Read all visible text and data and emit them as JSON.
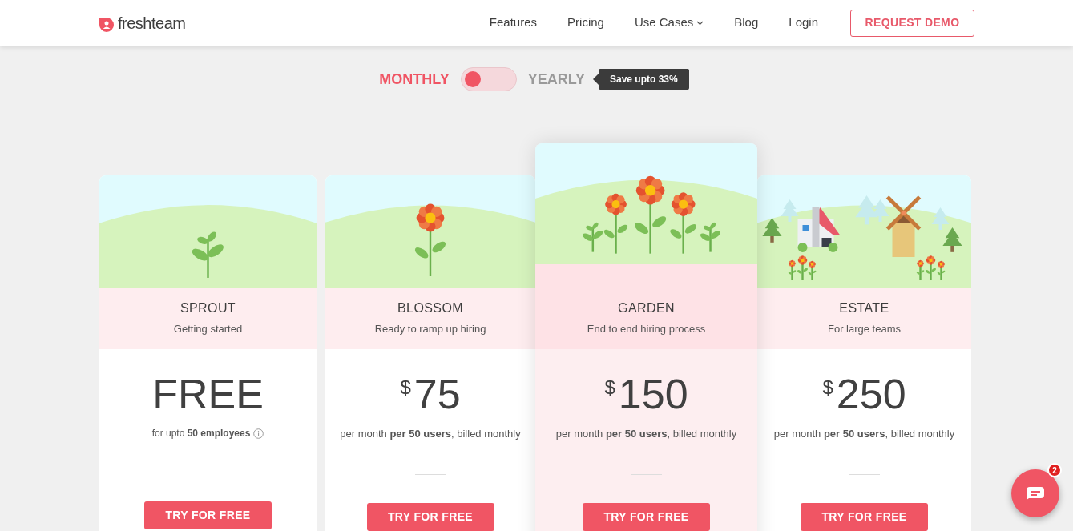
{
  "header": {
    "logo": "freshteam",
    "nav": [
      {
        "label": "Features",
        "kind": "link"
      },
      {
        "label": "Pricing",
        "kind": "link"
      },
      {
        "label": "Use Cases",
        "kind": "dropdown"
      },
      {
        "label": "Blog",
        "kind": "link"
      },
      {
        "label": "Login",
        "kind": "link"
      }
    ],
    "cta": "REQUEST DEMO"
  },
  "billing": {
    "options": [
      {
        "label": "MONTHLY",
        "selected": true
      },
      {
        "label": "YEARLY",
        "selected": false
      }
    ],
    "toggle_on": false,
    "tooltip": "Save upto 33%"
  },
  "plans": [
    {
      "kind": "sprout",
      "name": "SPROUT",
      "tagline": "Getting started",
      "highlighted": false,
      "price": {
        "kind": "free",
        "amount": "FREE"
      },
      "note": "for upto **50 employees**",
      "button": "TRY FOR FREE"
    },
    {
      "kind": "flower",
      "name": "BLOSSOM",
      "tagline": "Ready to ramp up hiring",
      "highlighted": false,
      "price": {
        "kind": "paid",
        "currency": "$",
        "amount": "75"
      },
      "note": "per month **per 50 users**, billed monthly",
      "button": "TRY FOR FREE"
    },
    {
      "kind": "garden",
      "name": "GARDEN",
      "tagline": "End to end hiring process",
      "highlighted": true,
      "price": {
        "kind": "paid",
        "currency": "$",
        "amount": "150"
      },
      "note": "per month **per 50 users**, billed monthly",
      "button": "TRY FOR FREE"
    },
    {
      "kind": "estate",
      "name": "ESTATE",
      "tagline": "For large teams",
      "highlighted": false,
      "price": {
        "kind": "paid",
        "currency": "$",
        "amount": "250"
      },
      "note": "per month **per 50 users**, billed monthly",
      "button": "TRY FOR FREE"
    }
  ],
  "chat": {
    "badge": "2"
  }
}
